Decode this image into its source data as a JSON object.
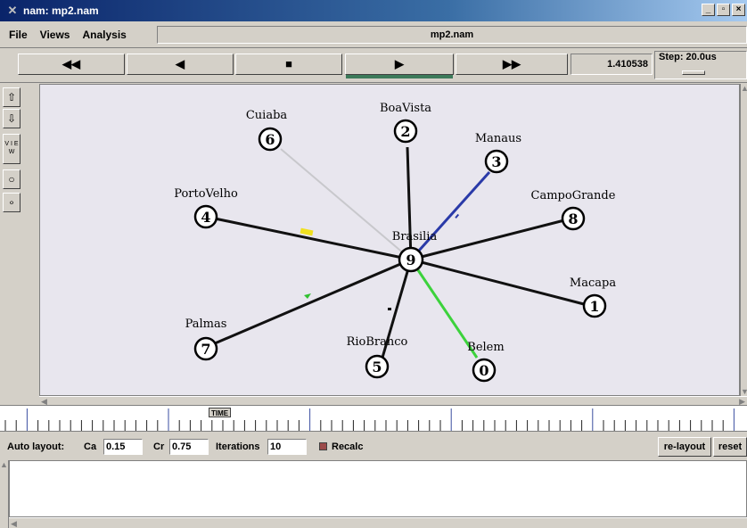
{
  "window": {
    "title": "nam: mp2.nam",
    "controls": [
      "_",
      "▫",
      "×"
    ]
  },
  "menu": {
    "items": [
      "File",
      "Views",
      "Analysis"
    ],
    "file_title": "mp2.nam"
  },
  "playback": {
    "buttons": [
      {
        "name": "rewind-button",
        "glyph": "◀◀"
      },
      {
        "name": "play-backward-button",
        "glyph": "◀"
      },
      {
        "name": "stop-button",
        "glyph": "■"
      },
      {
        "name": "play-forward-button",
        "glyph": "▶"
      },
      {
        "name": "fast-forward-button",
        "glyph": "▶▶"
      }
    ],
    "time": "1.410538",
    "step_label": "Step: 20.0us"
  },
  "tools": {
    "zoom_in": "⇧",
    "zoom_out": "⇩",
    "view": "V I E W",
    "circle_large": "○",
    "circle_small": "∘"
  },
  "network": {
    "nodes": [
      {
        "id": "9",
        "label": "Brasilia"
      },
      {
        "id": "6",
        "label": "Cuiaba"
      },
      {
        "id": "2",
        "label": "BoaVista"
      },
      {
        "id": "3",
        "label": "Manaus"
      },
      {
        "id": "4",
        "label": "PortoVelho"
      },
      {
        "id": "8",
        "label": "CampoGrande"
      },
      {
        "id": "1",
        "label": "Macapa"
      },
      {
        "id": "7",
        "label": "Palmas"
      },
      {
        "id": "5",
        "label": "RioBranco"
      },
      {
        "id": "0",
        "label": "Belem"
      }
    ],
    "colors": {
      "link_default": "#111111",
      "link_cuiaba": "#c8c8cc",
      "link_manaus": "#2a3aa8",
      "link_belem": "#3cd23c",
      "packet_yellow": "#f0e020",
      "packet_green": "#30c030"
    }
  },
  "timeline": {
    "marker_label": "TIME"
  },
  "auto_layout": {
    "label": "Auto layout:",
    "ca_label": "Ca",
    "ca_value": "0.15",
    "cr_label": "Cr",
    "cr_value": "0.75",
    "iterations_label": "Iterations",
    "iterations_value": "10",
    "recalc_label": "Recalc",
    "relayout_button": "re-layout",
    "reset_button": "reset"
  }
}
